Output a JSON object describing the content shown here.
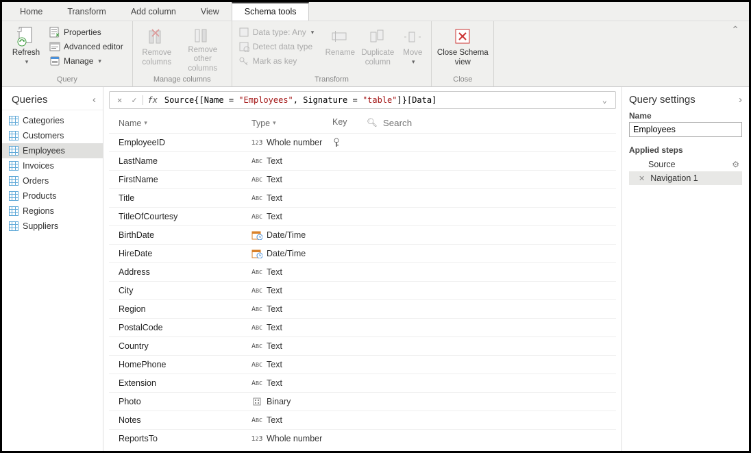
{
  "tabs": [
    "Home",
    "Transform",
    "Add column",
    "View",
    "Schema tools"
  ],
  "active_tab": "Schema tools",
  "ribbon": {
    "query": {
      "label": "Query",
      "refresh": "Refresh",
      "properties": "Properties",
      "advanced_editor": "Advanced editor",
      "manage": "Manage"
    },
    "manage_columns": {
      "label": "Manage columns",
      "remove_columns": "Remove columns",
      "remove_other": "Remove other columns"
    },
    "transform": {
      "label": "Transform",
      "data_type": "Data type: Any",
      "detect": "Detect data type",
      "mark_key": "Mark as key",
      "rename": "Rename",
      "duplicate_column": "Duplicate column",
      "move": "Move"
    },
    "close": {
      "label": "Close",
      "close_schema": "Close Schema view"
    }
  },
  "queries": {
    "title": "Queries",
    "items": [
      "Categories",
      "Customers",
      "Employees",
      "Invoices",
      "Orders",
      "Products",
      "Regions",
      "Suppliers"
    ],
    "selected": "Employees"
  },
  "formula": {
    "prefix": "Source{[Name = ",
    "name_literal": "\"Employees\"",
    "mid": ", Signature = ",
    "sig_literal": "\"table\"",
    "suffix": "]}[Data]"
  },
  "schema": {
    "headers": {
      "name": "Name",
      "type": "Type",
      "key": "Key",
      "search_placeholder": "Search"
    },
    "rows": [
      {
        "name": "EmployeeID",
        "type": "Whole number",
        "typeIcon": "num",
        "key": true
      },
      {
        "name": "LastName",
        "type": "Text",
        "typeIcon": "abc"
      },
      {
        "name": "FirstName",
        "type": "Text",
        "typeIcon": "abc"
      },
      {
        "name": "Title",
        "type": "Text",
        "typeIcon": "abc"
      },
      {
        "name": "TitleOfCourtesy",
        "type": "Text",
        "typeIcon": "abc"
      },
      {
        "name": "BirthDate",
        "type": "Date/Time",
        "typeIcon": "dt"
      },
      {
        "name": "HireDate",
        "type": "Date/Time",
        "typeIcon": "dt"
      },
      {
        "name": "Address",
        "type": "Text",
        "typeIcon": "abc"
      },
      {
        "name": "City",
        "type": "Text",
        "typeIcon": "abc"
      },
      {
        "name": "Region",
        "type": "Text",
        "typeIcon": "abc"
      },
      {
        "name": "PostalCode",
        "type": "Text",
        "typeIcon": "abc"
      },
      {
        "name": "Country",
        "type": "Text",
        "typeIcon": "abc"
      },
      {
        "name": "HomePhone",
        "type": "Text",
        "typeIcon": "abc"
      },
      {
        "name": "Extension",
        "type": "Text",
        "typeIcon": "abc"
      },
      {
        "name": "Photo",
        "type": "Binary",
        "typeIcon": "bin"
      },
      {
        "name": "Notes",
        "type": "Text",
        "typeIcon": "abc"
      },
      {
        "name": "ReportsTo",
        "type": "Whole number",
        "typeIcon": "num"
      }
    ]
  },
  "settings": {
    "title": "Query settings",
    "name_label": "Name",
    "name_value": "Employees",
    "applied_steps_label": "Applied steps",
    "steps": [
      {
        "label": "Source",
        "gear": true,
        "deletable": false,
        "selected": false
      },
      {
        "label": "Navigation 1",
        "gear": false,
        "deletable": true,
        "selected": true
      }
    ]
  }
}
